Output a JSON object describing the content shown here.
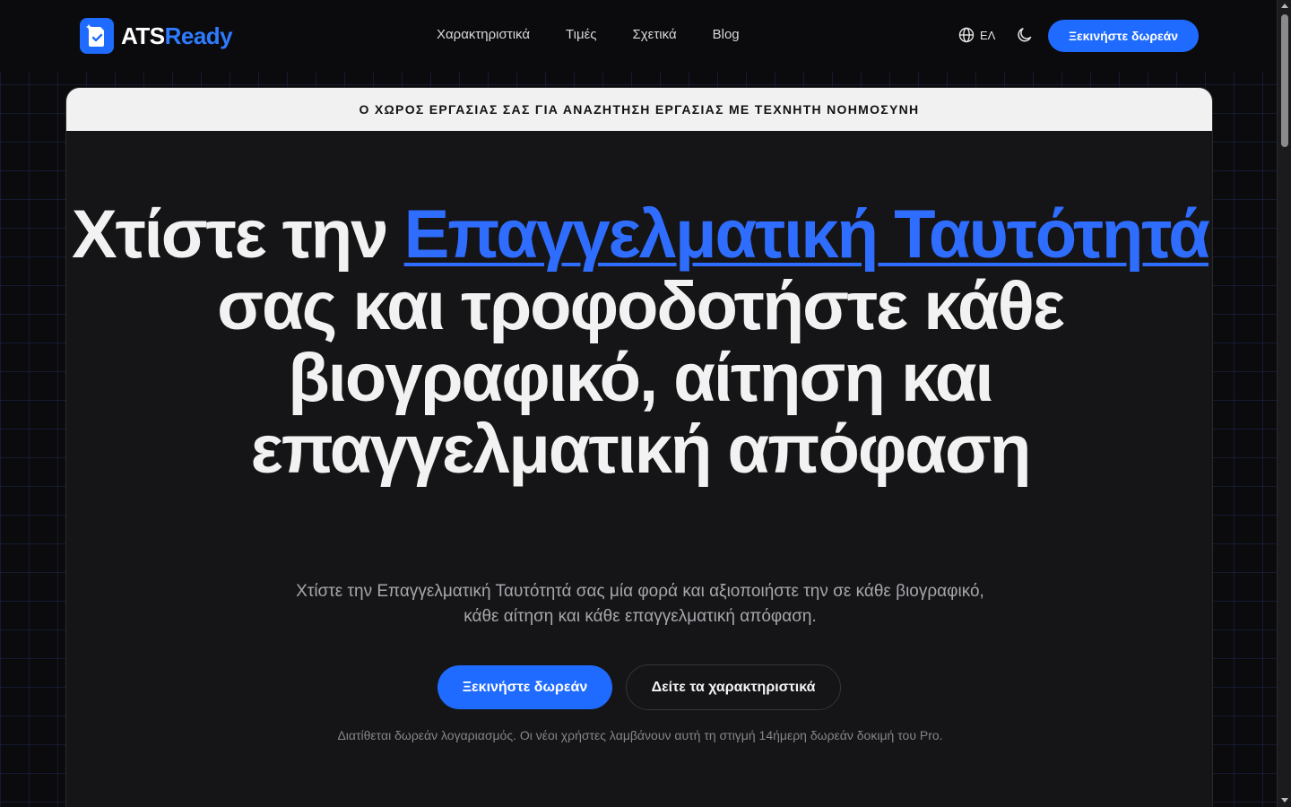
{
  "header": {
    "logo": {
      "part1": "ATS",
      "part2": "Ready",
      "icon": "document-check-icon"
    },
    "nav": [
      "Χαρακτηριστικά",
      "Τιμές",
      "Σχετικά",
      "Blog"
    ],
    "language": {
      "label": "ΕΛ",
      "icon": "globe-icon"
    },
    "theme_toggle_icon": "moon-icon",
    "cta_label": "Ξεκινήστε δωρεάν"
  },
  "hero": {
    "banner": "Ο ΧΩΡΟΣ ΕΡΓΑΣΙΑΣ ΣΑΣ ΓΙΑ ΑΝΑΖΗΤΗΣΗ ΕΡΓΑΣΙΑΣ ΜΕ ΤΕΧΝΗΤΗ ΝΟΗΜΟΣΥΝΗ",
    "headline_pre": "Χτίστε την ",
    "headline_highlight": "Επαγγελματική Ταυτότητά",
    "headline_post": " σας και τροφοδοτήστε κάθε βιογραφικό, αίτηση και επαγγελματική απόφαση",
    "subtitle": "Χτίστε την Επαγγελματική Ταυτότητά σας μία φορά και αξιοποιήστε την σε κάθε βιογραφικό, κάθε αίτηση και κάθε επαγγελματική απόφαση.",
    "primary_button": "Ξεκινήστε δωρεάν",
    "secondary_button": "Δείτε τα χαρακτηριστικά",
    "note": "Διατίθεται δωρεάν λογαριασμός. Οι νέοι χρήστες λαμβάνουν αυτή τη στιγμή 14ήμερη δωρεάν δοκιμή του Pro."
  },
  "colors": {
    "accent": "#1f6bff",
    "background": "#0b0b0e",
    "card": "#151517",
    "banner": "#f1f1f1"
  }
}
